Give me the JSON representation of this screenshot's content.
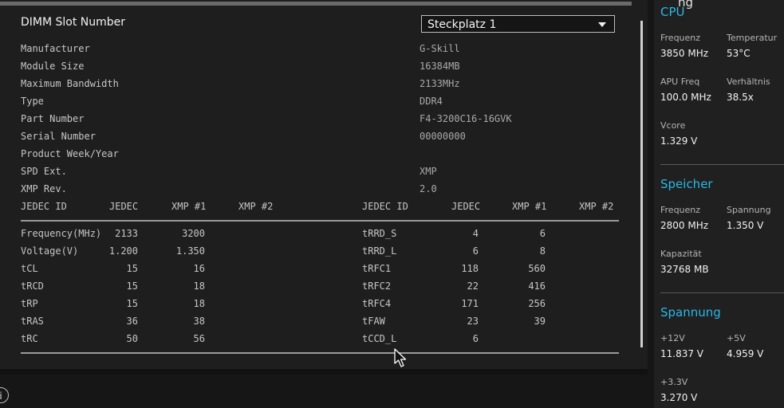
{
  "slot": {
    "label": "DIMM Slot Number",
    "selected": "Steckplatz 1"
  },
  "info": [
    {
      "label": "Manufacturer",
      "value": "G-Skill"
    },
    {
      "label": "Module Size",
      "value": "16384MB"
    },
    {
      "label": "Maximum Bandwidth",
      "value": "2133MHz"
    },
    {
      "label": "Type",
      "value": "DDR4"
    },
    {
      "label": "Part Number",
      "value": "F4-3200C16-16GVK"
    },
    {
      "label": "Serial Number",
      "value": "00000000"
    },
    {
      "label": "Product Week/Year",
      "value": ""
    },
    {
      "label": "SPD Ext.",
      "value": "XMP"
    },
    {
      "label": "XMP Rev.",
      "value": "2.0"
    }
  ],
  "timing_headers": {
    "left": [
      "JEDEC ID",
      "JEDEC",
      "XMP #1",
      "XMP #2"
    ],
    "right": [
      "JEDEC ID",
      "JEDEC",
      "XMP #1",
      "XMP #2"
    ]
  },
  "timings_left": [
    {
      "name": "Frequency(MHz)",
      "jedec": "2133",
      "xmp1": "3200",
      "xmp2": ""
    },
    {
      "name": "Voltage(V)",
      "jedec": "1.200",
      "xmp1": "1.350",
      "xmp2": ""
    },
    {
      "name": "tCL",
      "jedec": "15",
      "xmp1": "16",
      "xmp2": ""
    },
    {
      "name": "tRCD",
      "jedec": "15",
      "xmp1": "18",
      "xmp2": ""
    },
    {
      "name": "tRP",
      "jedec": "15",
      "xmp1": "18",
      "xmp2": ""
    },
    {
      "name": "tRAS",
      "jedec": "36",
      "xmp1": "38",
      "xmp2": ""
    },
    {
      "name": "tRC",
      "jedec": "50",
      "xmp1": "56",
      "xmp2": ""
    }
  ],
  "timings_right": [
    {
      "name": "tRRD_S",
      "jedec": "4",
      "xmp1": "6",
      "xmp2": ""
    },
    {
      "name": "tRRD_L",
      "jedec": "6",
      "xmp1": "8",
      "xmp2": ""
    },
    {
      "name": "tRFC1",
      "jedec": "118",
      "xmp1": "560",
      "xmp2": ""
    },
    {
      "name": "tRFC2",
      "jedec": "22",
      "xmp1": "416",
      "xmp2": ""
    },
    {
      "name": "tRFC4",
      "jedec": "171",
      "xmp1": "256",
      "xmp2": ""
    },
    {
      "name": "tFAW",
      "jedec": "23",
      "xmp1": "39",
      "xmp2": ""
    },
    {
      "name": "tCCD_L",
      "jedec": "6",
      "xmp1": "",
      "xmp2": ""
    }
  ],
  "sidebar": {
    "cut_title": "ng",
    "cpu": {
      "title": "CPU",
      "freq_label": "Frequenz",
      "freq_value": "3850 MHz",
      "temp_label": "Temperatur",
      "temp_value": "53°C",
      "apu_label": "APU Freq",
      "apu_value": "100.0 MHz",
      "ratio_label": "Verhältnis",
      "ratio_value": "38.5x",
      "vcore_label": "Vcore",
      "vcore_value": "1.329 V"
    },
    "memory": {
      "title": "Speicher",
      "freq_label": "Frequenz",
      "freq_value": "2800 MHz",
      "volt_label": "Spannung",
      "volt_value": "1.350 V",
      "cap_label": "Kapazität",
      "cap_value": "32768 MB"
    },
    "voltage": {
      "title": "Spannung",
      "v12_label": "+12V",
      "v12_value": "11.837 V",
      "v5_label": "+5V",
      "v5_value": "4.959 V",
      "v33_label": "+3.3V",
      "v33_value": "3.270 V"
    }
  },
  "icons": {
    "info": "info-icon",
    "cursor": "mouse-pointer-icon",
    "dropdown": "caret-down-icon"
  },
  "colors": {
    "accent": "#29b8e6",
    "background": "#1e1e1e",
    "sidebar": "#202020"
  }
}
